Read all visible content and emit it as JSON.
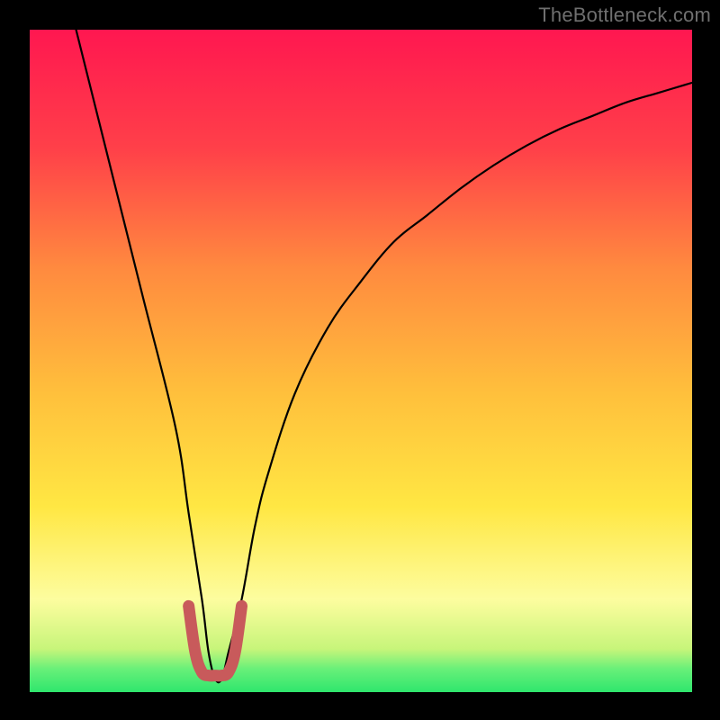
{
  "watermark": "TheBottleneck.com",
  "chart_data": {
    "type": "line",
    "title": "",
    "xlabel": "",
    "ylabel": "",
    "xlim": [
      0,
      100
    ],
    "ylim": [
      0,
      100
    ],
    "series": [
      {
        "name": "bottleneck-curve",
        "x": [
          7,
          12,
          17,
          22,
          24,
          26,
          27,
          28,
          29,
          30,
          32,
          34,
          36,
          40,
          45,
          50,
          55,
          60,
          65,
          70,
          75,
          80,
          85,
          90,
          95,
          100
        ],
        "y": [
          100,
          80,
          60,
          40,
          27,
          14,
          6,
          2,
          2,
          6,
          14,
          25,
          33,
          45,
          55,
          62,
          68,
          72,
          76,
          79.5,
          82.5,
          85,
          87,
          89,
          90.5,
          92
        ]
      },
      {
        "name": "optimal-range-marker",
        "x": [
          24,
          25,
          26,
          27,
          28,
          29,
          30,
          31,
          32
        ],
        "y": [
          13,
          6,
          3,
          2.5,
          2.5,
          2.5,
          3,
          6,
          13
        ]
      }
    ],
    "colors": {
      "curve": "#000000",
      "marker": "#c85a5b",
      "gradient_top": "#ff1750",
      "gradient_mid_orange": "#ff8a3f",
      "gradient_mid_yellow": "#ffe743",
      "gradient_pale": "#fdfd9f",
      "gradient_green": "#2fe66d"
    },
    "legend": null,
    "grid": false
  }
}
